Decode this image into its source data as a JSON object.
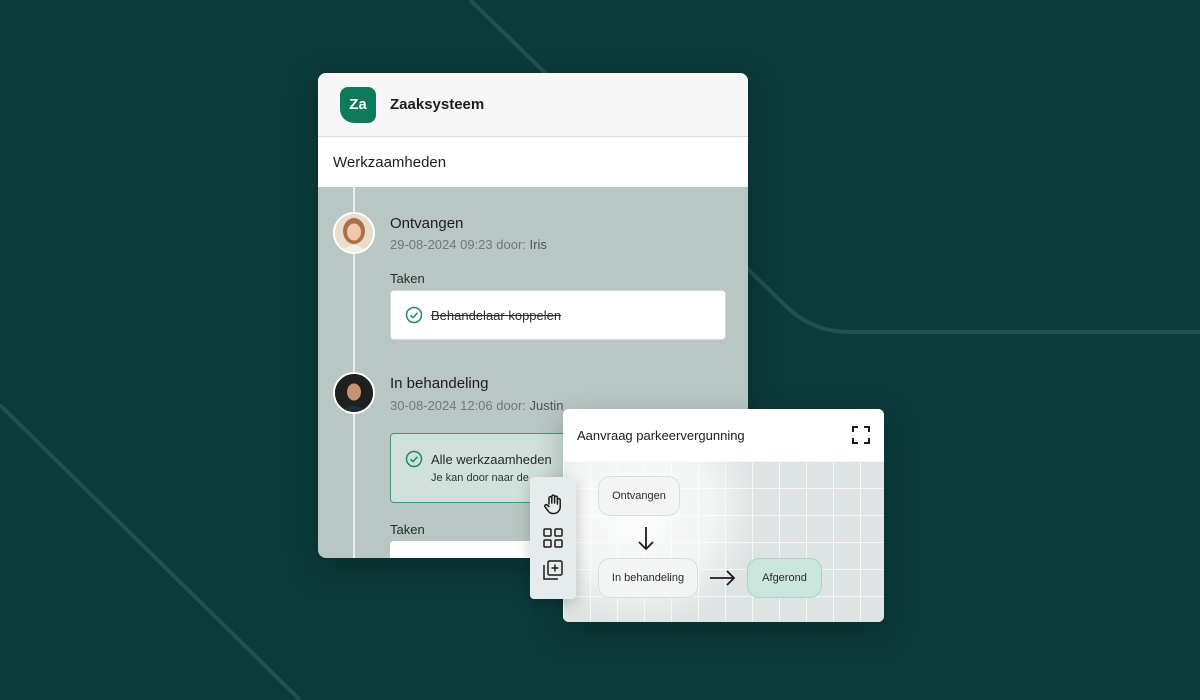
{
  "app": {
    "logo_text": "Za",
    "title": "Zaaksysteem",
    "brand_color": "#0d7a5a"
  },
  "section": {
    "title": "Werkzaamheden"
  },
  "timeline": [
    {
      "status": "Ontvangen",
      "meta": "29-08-2024 09:23 door:",
      "user": "Iris",
      "tasks_label": "Taken",
      "task": "Behandelaar koppelen",
      "task_done": true
    },
    {
      "status": "In behandeling",
      "meta": "30-08-2024 12:06 door:",
      "user": "Justin",
      "notice_title": "Alle werkzaamheden",
      "notice_sub": "Je kan door naar de",
      "tasks_label": "Taken"
    }
  ],
  "toolbar": {
    "tools": [
      "hand-icon",
      "grid-icon",
      "add-square-icon"
    ]
  },
  "flow": {
    "title": "Aanvraag parkeervergunning",
    "nodes": {
      "received": "Ontvangen",
      "in_progress": "In behandeling",
      "done": "Afgerond"
    },
    "done_color": "#c9e5dc"
  }
}
